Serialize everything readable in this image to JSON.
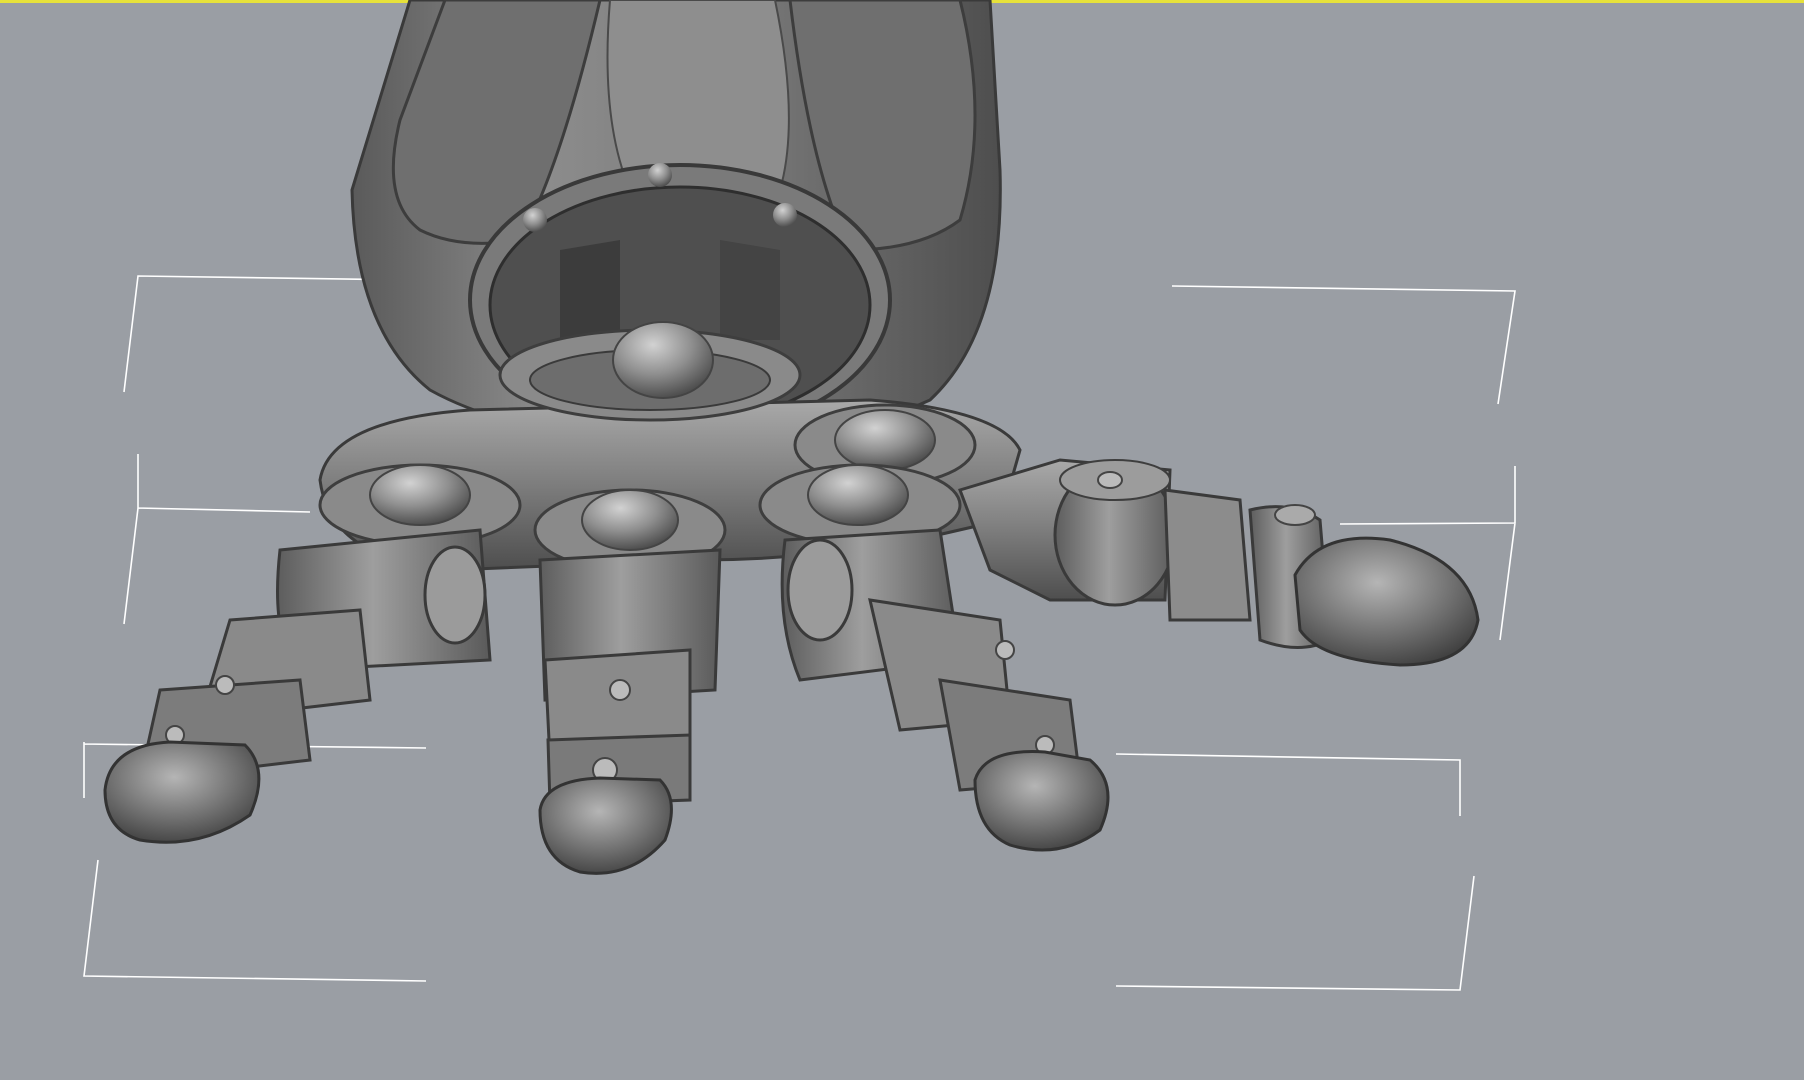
{
  "viewport": {
    "background_color": "#9a9ea4",
    "active_border_color": "#e7e23a",
    "selection_bracket_color": "#ffffff",
    "shading": "smooth-gray",
    "model": {
      "subject": "robotic-hand",
      "finger_count": 5
    }
  }
}
